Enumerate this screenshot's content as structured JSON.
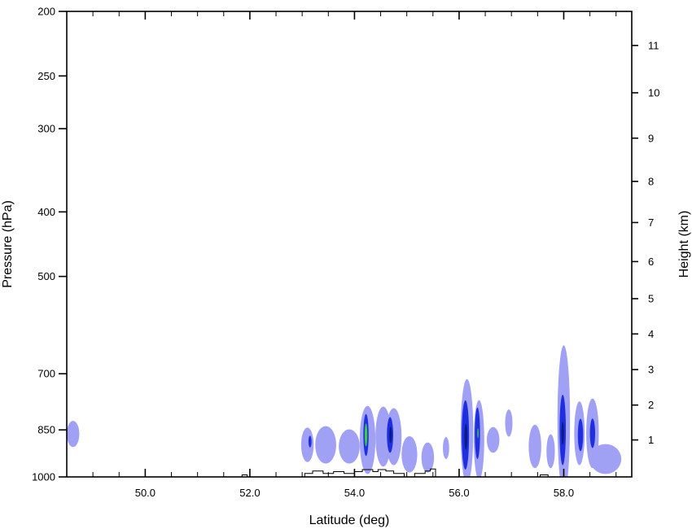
{
  "chart_data": {
    "type": "contour",
    "xlabel": "Latitude (deg)",
    "ylabel": "Pressure (hPa)",
    "y2label": "Height (km)",
    "xlim": [
      48.5,
      59.3
    ],
    "ylim": [
      1000,
      200
    ],
    "y_scale": "log",
    "x_ticks": [
      50.0,
      52.0,
      54.0,
      56.0,
      58.0
    ],
    "x_tick_labels": [
      "50.0",
      "52.0",
      "54.0",
      "56.0",
      "58.0"
    ],
    "x_minor_step": 0.5,
    "y_ticks": [
      1000,
      850,
      700,
      500,
      400,
      300,
      250,
      200
    ],
    "y2_ticks": [
      1,
      2,
      3,
      4,
      5,
      6,
      7,
      8,
      9,
      10,
      11
    ],
    "y2_ticks_pressure": [
      880,
      780,
      690,
      610,
      540,
      475,
      415,
      360,
      310,
      265,
      225
    ],
    "grid": false,
    "legend": "none",
    "colors": {
      "level1": "#a0a0f5",
      "level2": "#1e2fe0",
      "level3": "#0a1a8a",
      "level4": "#3ccf3c",
      "outline": "#000000"
    },
    "level1_blobs": [
      {
        "lat": 48.62,
        "p": 862,
        "dlat": 0.12,
        "dp": 40
      },
      {
        "lat": 53.1,
        "p": 895,
        "dlat": 0.12,
        "dp": 55
      },
      {
        "lat": 53.45,
        "p": 895,
        "dlat": 0.2,
        "dp": 60
      },
      {
        "lat": 53.9,
        "p": 900,
        "dlat": 0.2,
        "dp": 55
      },
      {
        "lat": 54.25,
        "p": 880,
        "dlat": 0.15,
        "dp": 110
      },
      {
        "lat": 54.55,
        "p": 870,
        "dlat": 0.15,
        "dp": 95
      },
      {
        "lat": 54.75,
        "p": 870,
        "dlat": 0.15,
        "dp": 90
      },
      {
        "lat": 55.05,
        "p": 925,
        "dlat": 0.15,
        "dp": 60
      },
      {
        "lat": 55.4,
        "p": 935,
        "dlat": 0.12,
        "dp": 50
      },
      {
        "lat": 55.75,
        "p": 905,
        "dlat": 0.06,
        "dp": 35
      },
      {
        "lat": 56.15,
        "p": 855,
        "dlat": 0.12,
        "dp": 170
      },
      {
        "lat": 56.38,
        "p": 880,
        "dlat": 0.1,
        "dp": 130
      },
      {
        "lat": 56.65,
        "p": 880,
        "dlat": 0.12,
        "dp": 40
      },
      {
        "lat": 56.95,
        "p": 830,
        "dlat": 0.07,
        "dp": 40
      },
      {
        "lat": 57.45,
        "p": 900,
        "dlat": 0.12,
        "dp": 70
      },
      {
        "lat": 57.75,
        "p": 915,
        "dlat": 0.08,
        "dp": 55
      },
      {
        "lat": 58.0,
        "p": 820,
        "dlat": 0.12,
        "dp": 240
      },
      {
        "lat": 58.3,
        "p": 860,
        "dlat": 0.1,
        "dp": 100
      },
      {
        "lat": 58.55,
        "p": 860,
        "dlat": 0.12,
        "dp": 110
      },
      {
        "lat": 58.8,
        "p": 940,
        "dlat": 0.3,
        "dp": 50
      }
    ],
    "level2_blobs": [
      {
        "lat": 53.15,
        "p": 885,
        "dlat": 0.03,
        "dp": 18
      },
      {
        "lat": 54.22,
        "p": 865,
        "dlat": 0.05,
        "dp": 65
      },
      {
        "lat": 54.68,
        "p": 865,
        "dlat": 0.06,
        "dp": 55
      },
      {
        "lat": 56.12,
        "p": 865,
        "dlat": 0.07,
        "dp": 110
      },
      {
        "lat": 56.35,
        "p": 860,
        "dlat": 0.05,
        "dp": 80
      },
      {
        "lat": 57.98,
        "p": 850,
        "dlat": 0.06,
        "dp": 110
      },
      {
        "lat": 58.32,
        "p": 865,
        "dlat": 0.05,
        "dp": 50
      },
      {
        "lat": 58.55,
        "p": 860,
        "dlat": 0.05,
        "dp": 45
      }
    ],
    "level3_blobs": [
      {
        "lat": 54.69,
        "p": 865,
        "dlat": 0.025,
        "dp": 25
      },
      {
        "lat": 56.13,
        "p": 870,
        "dlat": 0.03,
        "dp": 40
      },
      {
        "lat": 57.98,
        "p": 860,
        "dlat": 0.025,
        "dp": 35
      }
    ],
    "level4_blobs": [
      {
        "lat": 54.22,
        "p": 865,
        "dlat": 0.025,
        "dp": 35
      },
      {
        "lat": 56.36,
        "p": 860,
        "dlat": 0.012,
        "dp": 15
      }
    ],
    "outline_segments": [
      [
        [
          51.85,
          1000
        ],
        [
          51.85,
          993
        ],
        [
          51.95,
          993
        ],
        [
          51.95,
          1000
        ]
      ],
      [
        [
          53.05,
          1000
        ],
        [
          53.05,
          988
        ],
        [
          53.2,
          988
        ],
        [
          53.2,
          980
        ],
        [
          53.4,
          980
        ],
        [
          53.4,
          988
        ],
        [
          53.6,
          988
        ],
        [
          53.6,
          982
        ],
        [
          53.8,
          982
        ],
        [
          53.8,
          988
        ],
        [
          54.0,
          988
        ],
        [
          54.0,
          982
        ],
        [
          54.15,
          982
        ],
        [
          54.15,
          975
        ],
        [
          54.35,
          975
        ],
        [
          54.35,
          982
        ],
        [
          54.45,
          982
        ],
        [
          54.45,
          975
        ],
        [
          54.6,
          975
        ],
        [
          54.6,
          980
        ],
        [
          54.75,
          980
        ],
        [
          54.75,
          988
        ],
        [
          54.95,
          988
        ],
        [
          54.95,
          1000
        ]
      ],
      [
        [
          55.15,
          1000
        ],
        [
          55.15,
          988
        ],
        [
          55.35,
          988
        ],
        [
          55.35,
          980
        ],
        [
          55.45,
          980
        ],
        [
          55.45,
          973
        ],
        [
          55.55,
          973
        ],
        [
          55.55,
          1000
        ]
      ],
      [
        [
          57.55,
          1000
        ],
        [
          57.55,
          993
        ],
        [
          57.7,
          993
        ],
        [
          57.7,
          1000
        ]
      ]
    ]
  }
}
